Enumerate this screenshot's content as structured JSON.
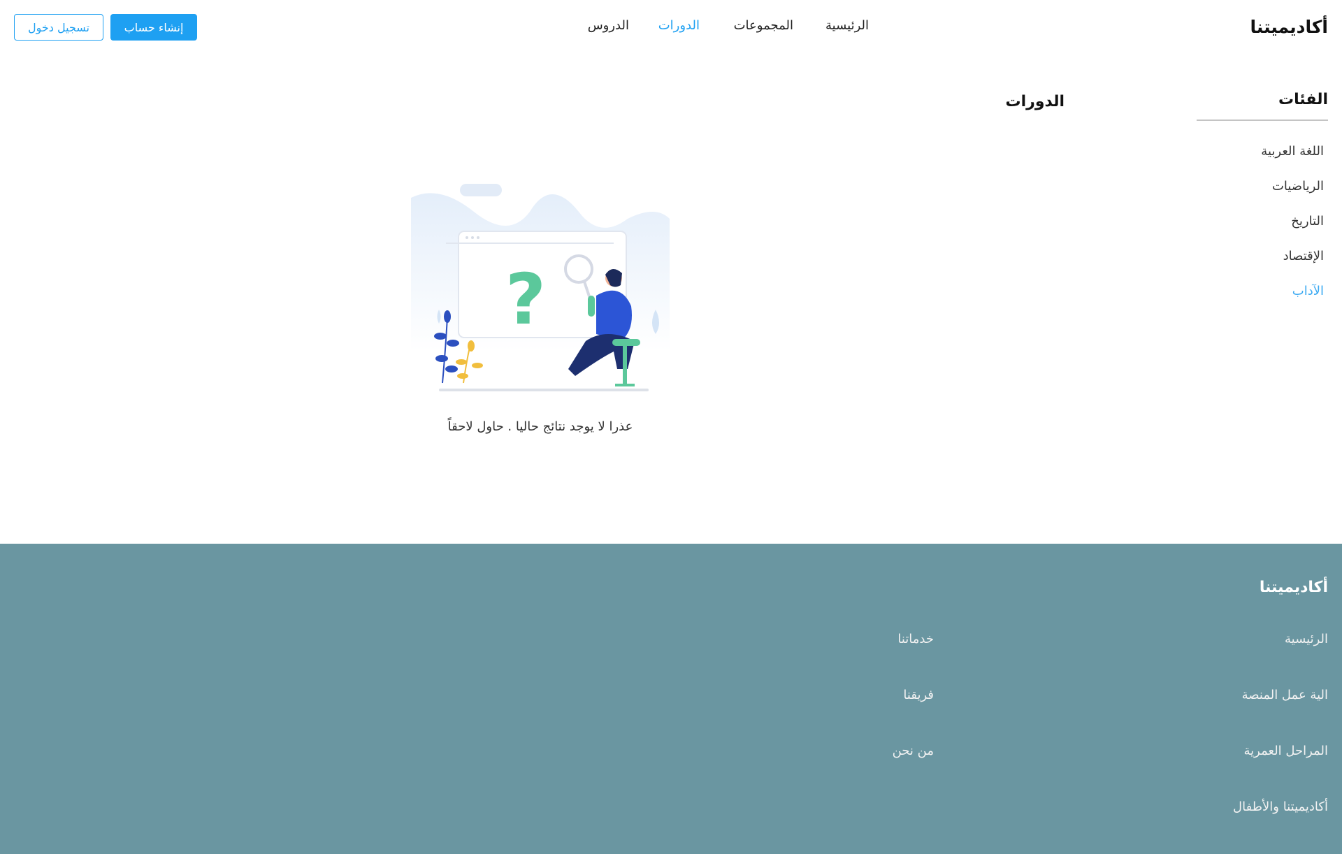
{
  "header": {
    "logo": "أكاديميتنا",
    "nav": [
      {
        "label": "الرئيسية",
        "active": false
      },
      {
        "label": "المجموعات",
        "active": false
      },
      {
        "label": "الدورات",
        "active": true
      },
      {
        "label": "الدروس",
        "active": false
      }
    ],
    "register_label": "إنشاء حساب",
    "login_label": "تسجيل دخول"
  },
  "sidebar": {
    "title": "الفئات",
    "items": [
      {
        "label": "اللغة العربية",
        "active": false
      },
      {
        "label": "الرياضيات",
        "active": false
      },
      {
        "label": "التاريخ",
        "active": false
      },
      {
        "label": "الإقتصاد",
        "active": false
      },
      {
        "label": "الآداب",
        "active": true
      }
    ]
  },
  "main": {
    "title": "الدورات",
    "empty_illustration": "no-results-illustration",
    "empty_message": "عذرا لا يوجد نتائج حاليا . حاول لاحقاً"
  },
  "footer": {
    "title": "أكاديميتنا",
    "col1": [
      "الرئيسية",
      "الية عمل المنصة",
      "المراحل العمرية",
      "أكاديميتنا والأطفال"
    ],
    "col2": [
      "خدماتنا",
      "فريقنا",
      "من نحن"
    ]
  },
  "colors": {
    "accent": "#1ea0f2",
    "footer_bg": "#6a96a1"
  }
}
